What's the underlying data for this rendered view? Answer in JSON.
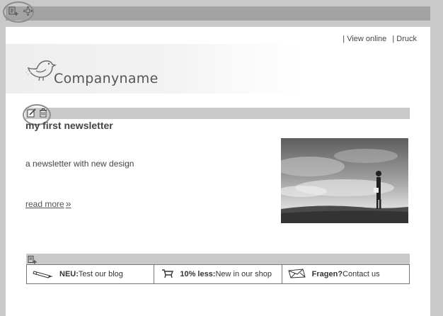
{
  "toolbar": {
    "icons": [
      "add-block-icon",
      "move-icon"
    ]
  },
  "header": {
    "sep1": "|",
    "view_online": "View online",
    "sep2": "|",
    "print": "Druck"
  },
  "logo": {
    "company_name": "Companyname",
    "icon": "bird-icon"
  },
  "article": {
    "icons": [
      "edit-icon",
      "delete-icon"
    ],
    "title": "my first newsletter",
    "text": "a newsletter with new design",
    "read_more": "read more",
    "read_more_arrow": "»",
    "image": "person-in-field-photo"
  },
  "footer": {
    "icon": "add-block-icon",
    "items": [
      {
        "icon": "pencil-icon",
        "bold": "NEU:",
        "text": "Test our blog"
      },
      {
        "icon": "cart-icon",
        "bold": "10% less:",
        "text": "New in our shop"
      },
      {
        "icon": "envelope-icon",
        "bold": "Fragen?",
        "text": "Contact us"
      }
    ]
  },
  "colors": {
    "background": "#c9c9c9",
    "toolbar": "#a3a3a3",
    "canvas": "#ffffff",
    "text": "#444444"
  }
}
